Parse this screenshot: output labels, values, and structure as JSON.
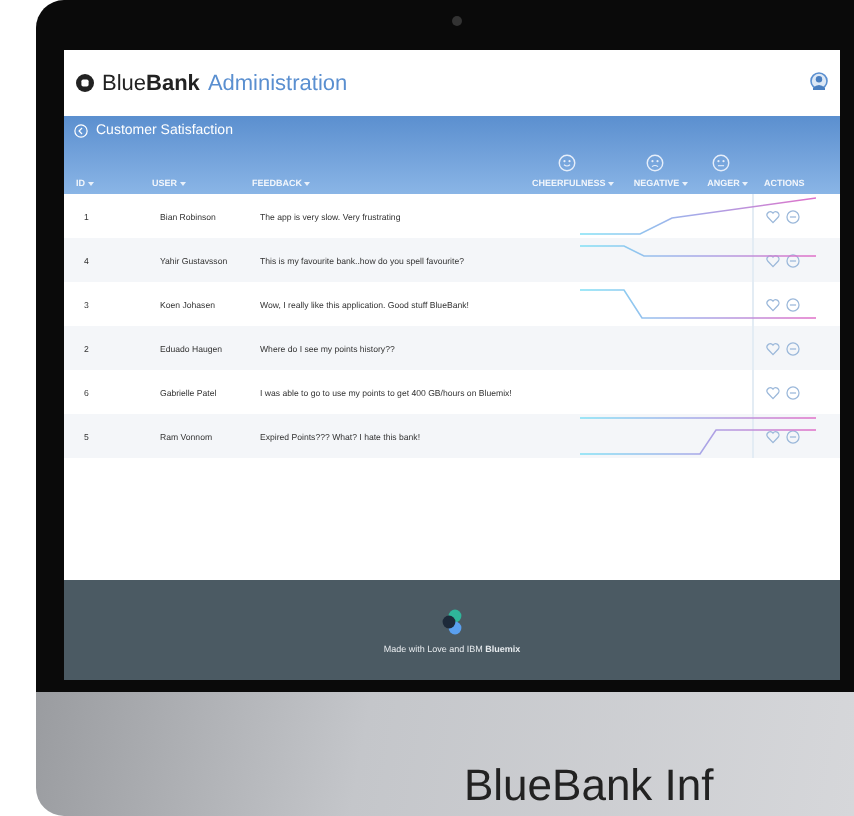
{
  "header": {
    "brand": "Blue**Bank**",
    "section": "Administration"
  },
  "band": {
    "title": "Customer Satisfaction",
    "columns": [
      {
        "label": "ID",
        "sortable": true
      },
      {
        "label": "USER",
        "sortable": true
      },
      {
        "label": "FEEDBACK",
        "sortable": true
      }
    ],
    "sentiment_columns": [
      {
        "label": "CHEERFULNESS",
        "sortable": true
      },
      {
        "label": "NEGATIVE",
        "sortable": true
      },
      {
        "label": "ANGER",
        "sortable": true
      }
    ],
    "actions_label": "ACTIONS"
  },
  "rows": [
    {
      "id": "1",
      "user": "Bian Robinson",
      "feedback": "The app is very slow. Very frustrating"
    },
    {
      "id": "4",
      "user": "Yahir Gustavsson",
      "feedback": "This is my favourite bank..how do you spell favourite?"
    },
    {
      "id": "3",
      "user": "Koen Johasen",
      "feedback": "Wow, I really like this application. Good stuff BlueBank!"
    },
    {
      "id": "2",
      "user": "Eduado Haugen",
      "feedback": "Where do I see my points history??"
    },
    {
      "id": "6",
      "user": "Gabrielle Patel",
      "feedback": "I was able to go to use my points to get 400 GB/hours on Bluemix!"
    },
    {
      "id": "5",
      "user": "Ram Vonnom",
      "feedback": "Expired Points??? What? I hate this bank!"
    }
  ],
  "footer": {
    "text": "Made with Love and IBM **Bluemix**"
  },
  "monitor_caption": "BlueBank Inf"
}
